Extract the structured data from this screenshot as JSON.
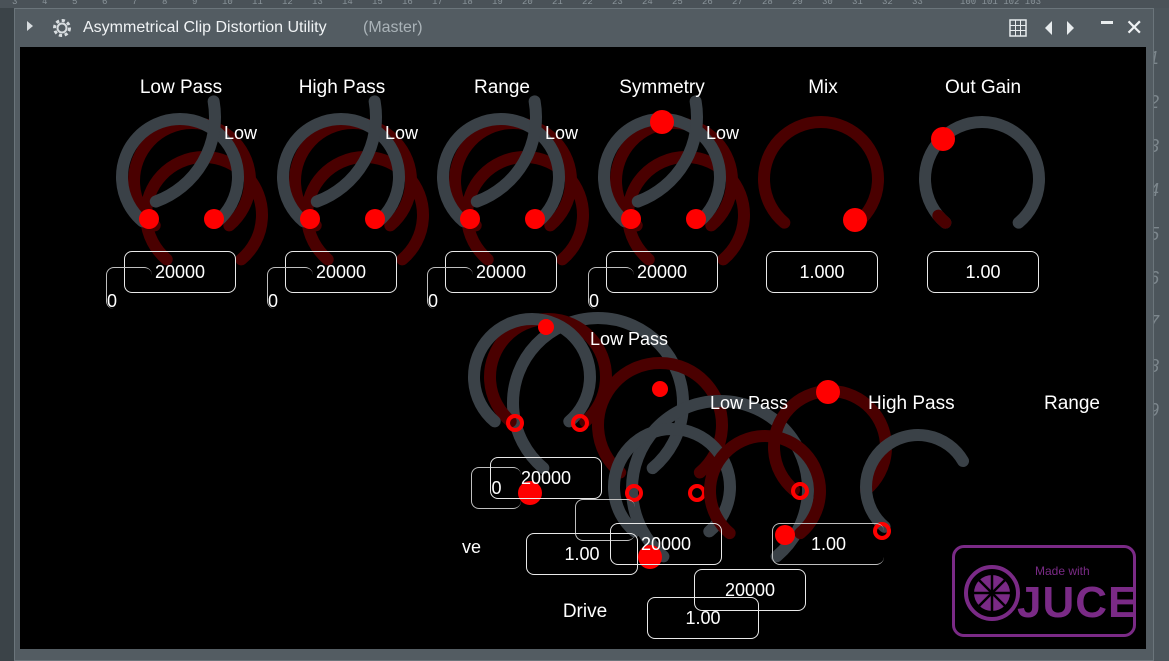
{
  "window": {
    "title": "Asymmetrical Clip Distortion Utility",
    "subtitle": "(Master)"
  },
  "host": {
    "ruler_numbers": [
      "3",
      "4",
      "5",
      "6",
      "7",
      "8",
      "9",
      "10",
      "11",
      "12",
      "13",
      "14",
      "15",
      "16",
      "17",
      "18",
      "19",
      "20",
      "21",
      "22",
      "23",
      "24",
      "25",
      "26",
      "27",
      "28",
      "29",
      "30",
      "31",
      "32",
      "33"
    ],
    "ruler_right": "100 101 102 103",
    "right_column": [
      "1",
      "2",
      "3",
      "4",
      "5",
      "6",
      "7",
      "8",
      "9"
    ]
  },
  "controls": {
    "low_pass": {
      "label": "Low Pass",
      "min_text": "0",
      "value": "20000",
      "overlay": "Low"
    },
    "high_pass": {
      "label": "High Pass",
      "min_text": "0",
      "value": "20000",
      "overlay": "Low"
    },
    "range": {
      "label": "Range",
      "min_text": "0",
      "value": "20000",
      "overlay": "Low"
    },
    "symmetry": {
      "label": "Symmetry",
      "min_text": "0",
      "value": "20000",
      "overlay": "Low"
    },
    "mix": {
      "label": "Mix",
      "value": "1.000"
    },
    "out_gain": {
      "label": "Out Gain",
      "value": "1.00"
    }
  },
  "glitch": {
    "low_pass_1": "Low Pass",
    "low_pass_2": "Low Pass",
    "high_pass": "High Pass",
    "range": "Range",
    "drive_partial": "ve",
    "drive": "Drive",
    "drive_value": "1.00",
    "value_a": "1.00",
    "value_b": "1.00",
    "value_c": "20000",
    "value_d": "20000",
    "value_e": "20000",
    "value_f": "0"
  },
  "badge": {
    "made_with": "Made with",
    "brand": "JUCE"
  },
  "colors": {
    "accent": "#ff0000",
    "dark_red": "#4a0000",
    "knob_grey": "#3a4147",
    "brand": "#7a2a86"
  }
}
